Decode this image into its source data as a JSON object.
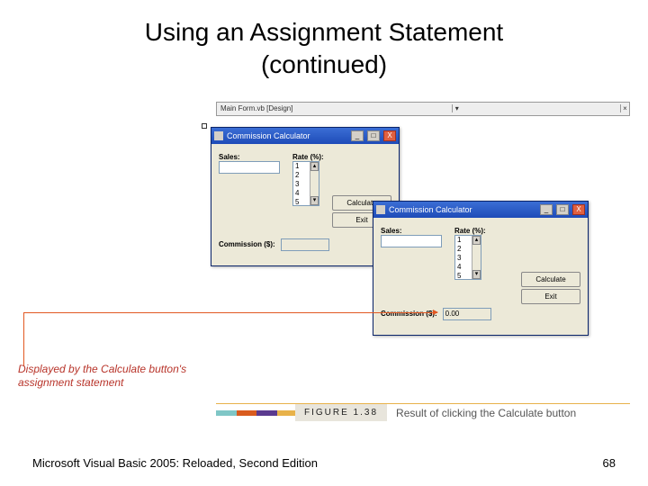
{
  "slide": {
    "title_line1": "Using an Assignment Statement",
    "title_line2": "(continued)"
  },
  "tab": {
    "label": "Main Form.vb [Design]"
  },
  "designWindow": {
    "title": "Commission Calculator",
    "salesLabel": "Sales:",
    "rateLabel": "Rate (%):",
    "rateOptions": [
      "1",
      "2",
      "3",
      "4",
      "5"
    ],
    "commissionLabel": "Commission ($):",
    "commissionValue": "",
    "calcBtn": "Calculate",
    "exitBtn": "Exit"
  },
  "runtimeWindow": {
    "title": "Commission Calculator",
    "salesLabel": "Sales:",
    "rateLabel": "Rate (%):",
    "rateOptions": [
      "1",
      "2",
      "3",
      "4",
      "5"
    ],
    "commissionLabel": "Commission ($):",
    "commissionValue": "0.00",
    "calcBtn": "Calculate",
    "exitBtn": "Exit"
  },
  "callout": {
    "line1": "Displayed by the Calculate button's",
    "line2": "assignment statement"
  },
  "figure": {
    "label": "FIGURE 1.38",
    "caption": "Result of clicking the Calculate button"
  },
  "footer": {
    "left": "Microsoft Visual Basic 2005: Reloaded, Second Edition",
    "right": "68"
  }
}
